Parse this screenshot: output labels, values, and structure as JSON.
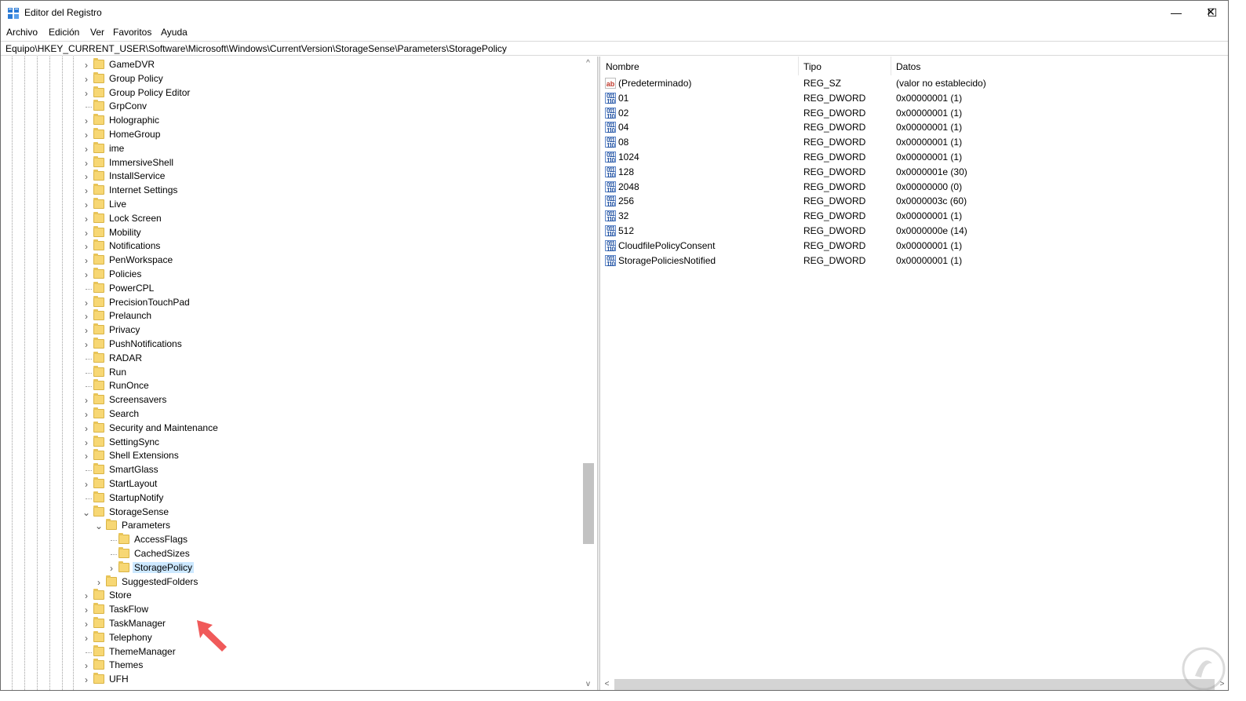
{
  "window": {
    "title": "Editor del Registro",
    "controls": {
      "minimize": "—",
      "maximize": "☐",
      "close": "✕"
    }
  },
  "menu": [
    "Archivo",
    "Edición",
    "Ver",
    "Favoritos",
    "Ayuda"
  ],
  "address": "Equipo\\HKEY_CURRENT_USER\\Software\\Microsoft\\Windows\\CurrentVersion\\StorageSense\\Parameters\\StoragePolicy",
  "tree": [
    {
      "label": "GameDVR",
      "depth": 0,
      "expander": "collapsed"
    },
    {
      "label": "Group Policy",
      "depth": 0,
      "expander": "collapsed"
    },
    {
      "label": "Group Policy Editor",
      "depth": 0,
      "expander": "collapsed"
    },
    {
      "label": "GrpConv",
      "depth": 0,
      "expander": "none"
    },
    {
      "label": "Holographic",
      "depth": 0,
      "expander": "collapsed"
    },
    {
      "label": "HomeGroup",
      "depth": 0,
      "expander": "collapsed"
    },
    {
      "label": "ime",
      "depth": 0,
      "expander": "collapsed"
    },
    {
      "label": "ImmersiveShell",
      "depth": 0,
      "expander": "collapsed"
    },
    {
      "label": "InstallService",
      "depth": 0,
      "expander": "collapsed"
    },
    {
      "label": "Internet Settings",
      "depth": 0,
      "expander": "collapsed"
    },
    {
      "label": "Live",
      "depth": 0,
      "expander": "collapsed"
    },
    {
      "label": "Lock Screen",
      "depth": 0,
      "expander": "collapsed"
    },
    {
      "label": "Mobility",
      "depth": 0,
      "expander": "collapsed"
    },
    {
      "label": "Notifications",
      "depth": 0,
      "expander": "collapsed"
    },
    {
      "label": "PenWorkspace",
      "depth": 0,
      "expander": "collapsed"
    },
    {
      "label": "Policies",
      "depth": 0,
      "expander": "collapsed"
    },
    {
      "label": "PowerCPL",
      "depth": 0,
      "expander": "none"
    },
    {
      "label": "PrecisionTouchPad",
      "depth": 0,
      "expander": "collapsed"
    },
    {
      "label": "Prelaunch",
      "depth": 0,
      "expander": "collapsed"
    },
    {
      "label": "Privacy",
      "depth": 0,
      "expander": "collapsed"
    },
    {
      "label": "PushNotifications",
      "depth": 0,
      "expander": "collapsed"
    },
    {
      "label": "RADAR",
      "depth": 0,
      "expander": "none"
    },
    {
      "label": "Run",
      "depth": 0,
      "expander": "none"
    },
    {
      "label": "RunOnce",
      "depth": 0,
      "expander": "none"
    },
    {
      "label": "Screensavers",
      "depth": 0,
      "expander": "collapsed"
    },
    {
      "label": "Search",
      "depth": 0,
      "expander": "collapsed"
    },
    {
      "label": "Security and Maintenance",
      "depth": 0,
      "expander": "collapsed"
    },
    {
      "label": "SettingSync",
      "depth": 0,
      "expander": "collapsed"
    },
    {
      "label": "Shell Extensions",
      "depth": 0,
      "expander": "collapsed"
    },
    {
      "label": "SmartGlass",
      "depth": 0,
      "expander": "none"
    },
    {
      "label": "StartLayout",
      "depth": 0,
      "expander": "collapsed"
    },
    {
      "label": "StartupNotify",
      "depth": 0,
      "expander": "none"
    },
    {
      "label": "StorageSense",
      "depth": 0,
      "expander": "expanded"
    },
    {
      "label": "Parameters",
      "depth": 1,
      "expander": "expanded"
    },
    {
      "label": "AccessFlags",
      "depth": 2,
      "expander": "none"
    },
    {
      "label": "CachedSizes",
      "depth": 2,
      "expander": "none"
    },
    {
      "label": "StoragePolicy",
      "depth": 2,
      "expander": "collapsed",
      "selected": true
    },
    {
      "label": "SuggestedFolders",
      "depth": 1,
      "expander": "collapsed"
    },
    {
      "label": "Store",
      "depth": 0,
      "expander": "collapsed"
    },
    {
      "label": "TaskFlow",
      "depth": 0,
      "expander": "collapsed"
    },
    {
      "label": "TaskManager",
      "depth": 0,
      "expander": "collapsed"
    },
    {
      "label": "Telephony",
      "depth": 0,
      "expander": "collapsed"
    },
    {
      "label": "ThemeManager",
      "depth": 0,
      "expander": "none"
    },
    {
      "label": "Themes",
      "depth": 0,
      "expander": "collapsed"
    },
    {
      "label": "UFH",
      "depth": 0,
      "expander": "collapsed"
    }
  ],
  "list": {
    "columns": [
      "Nombre",
      "Tipo",
      "Datos"
    ],
    "rows": [
      {
        "icon": "string-value-icon",
        "name": "(Predeterminado)",
        "type": "REG_SZ",
        "data": "(valor no establecido)"
      },
      {
        "icon": "dword-value-icon",
        "name": "01",
        "type": "REG_DWORD",
        "data": "0x00000001 (1)"
      },
      {
        "icon": "dword-value-icon",
        "name": "02",
        "type": "REG_DWORD",
        "data": "0x00000001 (1)"
      },
      {
        "icon": "dword-value-icon",
        "name": "04",
        "type": "REG_DWORD",
        "data": "0x00000001 (1)"
      },
      {
        "icon": "dword-value-icon",
        "name": "08",
        "type": "REG_DWORD",
        "data": "0x00000001 (1)"
      },
      {
        "icon": "dword-value-icon",
        "name": "1024",
        "type": "REG_DWORD",
        "data": "0x00000001 (1)"
      },
      {
        "icon": "dword-value-icon",
        "name": "128",
        "type": "REG_DWORD",
        "data": "0x0000001e (30)"
      },
      {
        "icon": "dword-value-icon",
        "name": "2048",
        "type": "REG_DWORD",
        "data": "0x00000000 (0)"
      },
      {
        "icon": "dword-value-icon",
        "name": "256",
        "type": "REG_DWORD",
        "data": "0x0000003c (60)"
      },
      {
        "icon": "dword-value-icon",
        "name": "32",
        "type": "REG_DWORD",
        "data": "0x00000001 (1)"
      },
      {
        "icon": "dword-value-icon",
        "name": "512",
        "type": "REG_DWORD",
        "data": "0x0000000e (14)"
      },
      {
        "icon": "dword-value-icon",
        "name": "CloudfilePolicyConsent",
        "type": "REG_DWORD",
        "data": "0x00000001 (1)"
      },
      {
        "icon": "dword-value-icon",
        "name": "StoragePoliciesNotified",
        "type": "REG_DWORD",
        "data": "0x00000001 (1)"
      }
    ]
  },
  "icons": {
    "string_glyph": "ab",
    "dword_glyph": "011\n110",
    "chevron_right": "›",
    "chevron_down": "⌄",
    "scroll_up": "^",
    "scroll_down": "v",
    "scroll_left": "<",
    "scroll_right": ">"
  },
  "colors": {
    "selection": "#cce8ff",
    "folder": "#f7d774",
    "annotation_arrow": "#f05a5a"
  }
}
